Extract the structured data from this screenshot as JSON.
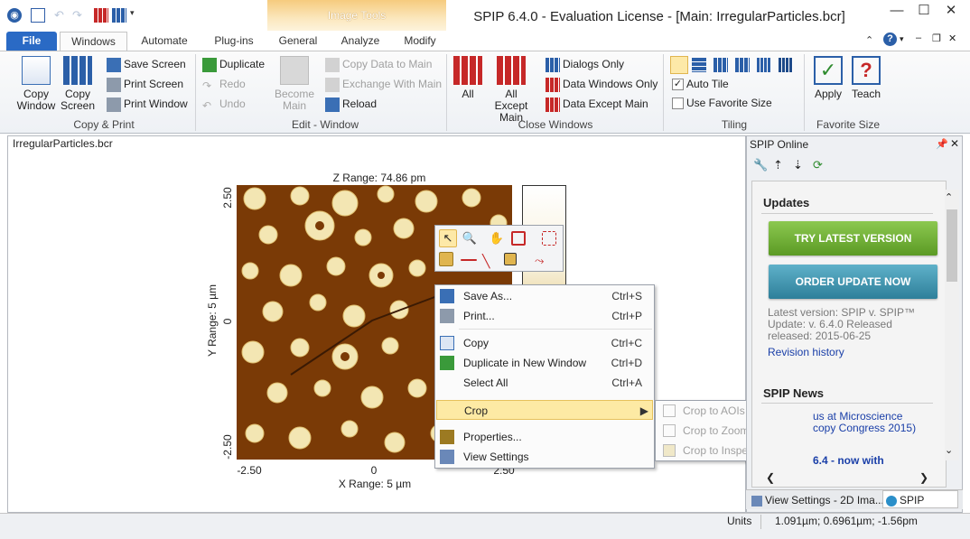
{
  "window": {
    "title": "SPIP 6.4.0 - Evaluation License - [Main: IrregularParticles.bcr]",
    "context_tab": "Image Tools",
    "controls": [
      "minimize-icon",
      "maximize-icon",
      "close-icon"
    ]
  },
  "tabs": [
    "File",
    "Windows",
    "Automate",
    "Plug-ins",
    "General",
    "Analyze",
    "Modify"
  ],
  "active_tab": "Windows",
  "ribbon": {
    "copy_print": {
      "label": "Copy & Print",
      "copy_window": "Copy Window",
      "copy_screen": "Copy Screen",
      "save_screen": "Save Screen",
      "print_screen": "Print Screen",
      "print_window": "Print Window"
    },
    "edit_window": {
      "label": "Edit - Window",
      "duplicate": "Duplicate",
      "redo": "Redo",
      "undo": "Undo",
      "become_main": "Become Main",
      "copy_data_to_main": "Copy Data to Main",
      "exchange_with_main": "Exchange With Main",
      "reload": "Reload"
    },
    "close_windows": {
      "label": "Close Windows",
      "all": "All",
      "all_except_main": "All Except Main",
      "dialogs_only": "Dialogs Only",
      "data_windows_only": "Data Windows Only",
      "data_except_main": "Data Except Main"
    },
    "tiling": {
      "label": "Tiling",
      "auto_tile": "Auto Tile",
      "auto_tile_checked": true,
      "use_favorite_size": "Use Favorite Size",
      "use_favorite_size_checked": false
    },
    "favorite_size": {
      "label": "Favorite Size",
      "apply": "Apply",
      "teach": "Teach"
    }
  },
  "document": {
    "title": "IrregularParticles.bcr",
    "z_range": "Z Range:  74.86 pm",
    "y_label": "Y Range: 5 µm",
    "x_label": "X Range: 5 µm",
    "y_ticks": [
      "2.50",
      "0",
      "-2.50"
    ],
    "x_ticks": [
      "-2.50",
      "0",
      "2.50"
    ]
  },
  "context_menu": {
    "items": [
      {
        "label": "Save As...",
        "shortcut": "Ctrl+S",
        "icon": "save-icon"
      },
      {
        "label": "Print...",
        "shortcut": "Ctrl+P",
        "icon": "printer-icon"
      },
      {
        "label": "Copy",
        "shortcut": "Ctrl+C",
        "icon": "copy-icon"
      },
      {
        "label": "Duplicate in New Window",
        "shortcut": "Ctrl+D",
        "icon": "duplicate-icon"
      },
      {
        "label": "Select All",
        "shortcut": "Ctrl+A",
        "icon": ""
      },
      {
        "label": "Crop",
        "shortcut": "",
        "icon": ""
      },
      {
        "label": "Properties...",
        "shortcut": "",
        "icon": "properties-icon"
      },
      {
        "label": "View Settings",
        "shortcut": "",
        "icon": "view-settings-icon"
      }
    ],
    "crop_submenu": [
      "Crop to AOIs",
      "Crop to Zoom Level",
      "Crop to Inspection Box"
    ]
  },
  "right_panel": {
    "title": "SPIP Online",
    "updates_heading": "Updates",
    "try_latest": "TRY LATEST VERSION",
    "order_update": "ORDER UPDATE NOW",
    "version_text": "Latest version: SPIP v. SPIP™ Update: v. 6.4.0 Released released: 2015-06-25",
    "revision_history": "Revision history",
    "news_heading": "SPIP News",
    "news_1": "us at Microscience copy Congress 2015)",
    "news_2": "6.4 - now with"
  },
  "bottom_tabs": [
    "View Settings - 2D Ima...",
    "SPIP Online"
  ],
  "status": {
    "units_label": "Units",
    "coords": "1.091µm; 0.6961µm; -1.56pm"
  },
  "colors": {
    "accent_blue": "#2a6ac5",
    "particle_brown": "#7a3a06",
    "particle_cream": "#f3e6b3",
    "green_button": "#6fb23a",
    "teal_button": "#3a94ad"
  }
}
